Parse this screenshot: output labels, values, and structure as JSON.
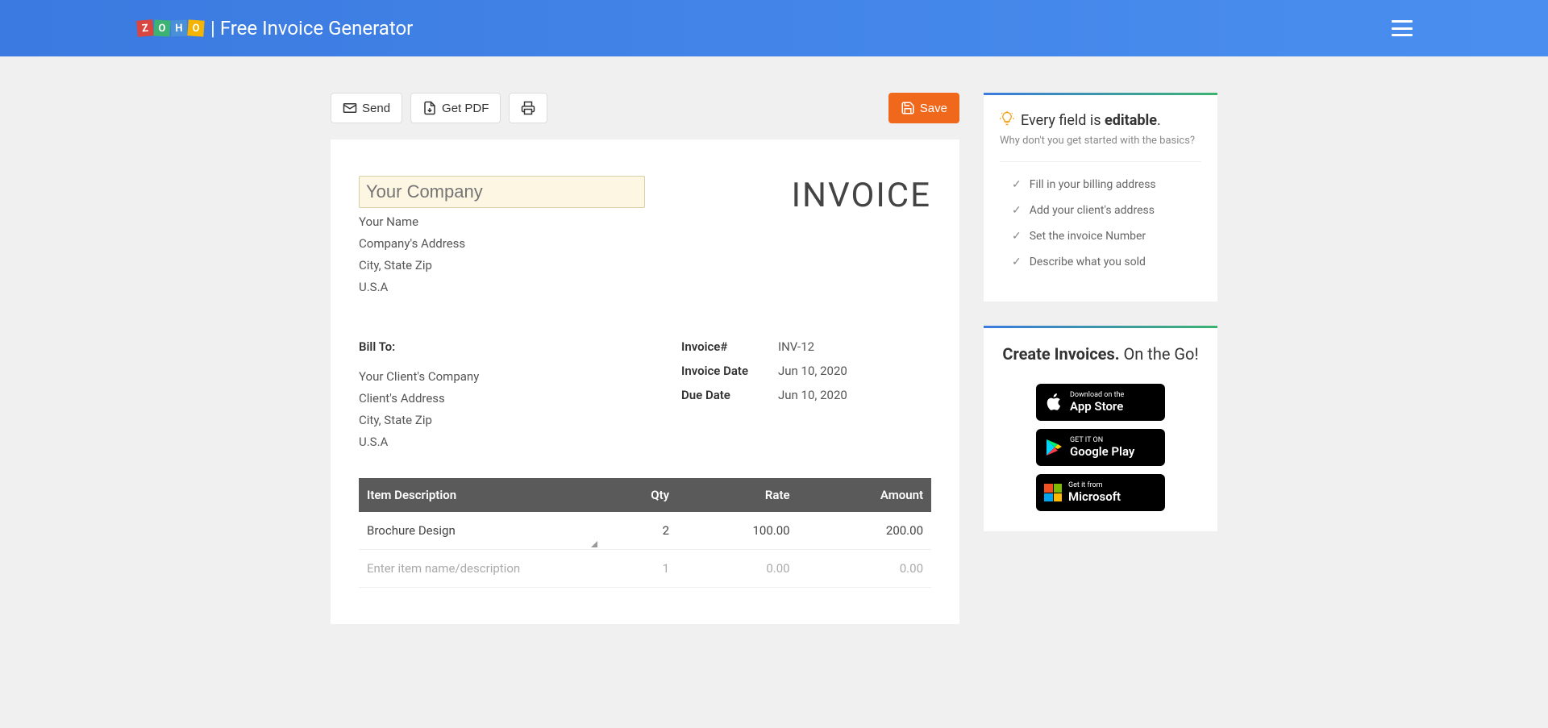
{
  "header": {
    "title": "| Free Invoice Generator"
  },
  "toolbar": {
    "send": "Send",
    "getPdf": "Get PDF",
    "save": "Save"
  },
  "invoice": {
    "companyPlaceholder": "Your Company",
    "yourName": "Your Name",
    "companyAddress": "Company's Address",
    "cityStateZip": "City, State Zip",
    "country": "U.S.A",
    "title": "INVOICE",
    "billToLabel": "Bill To:",
    "clientCompany": "Your Client's Company",
    "clientAddress": "Client's Address",
    "clientCity": "City, State Zip",
    "clientCountry": "U.S.A",
    "meta": {
      "invoiceNumLabel": "Invoice#",
      "invoiceNum": "INV-12",
      "invoiceDateLabel": "Invoice Date",
      "invoiceDate": "Jun 10, 2020",
      "dueDateLabel": "Due Date",
      "dueDate": "Jun 10, 2020"
    },
    "columns": {
      "desc": "Item Description",
      "qty": "Qty",
      "rate": "Rate",
      "amount": "Amount"
    },
    "items": [
      {
        "desc": "Brochure Design",
        "qty": "2",
        "rate": "100.00",
        "amount": "200.00"
      }
    ],
    "emptyRow": {
      "desc": "Enter item name/description",
      "qty": "1",
      "rate": "0.00",
      "amount": "0.00"
    }
  },
  "sidebar": {
    "editablePrefix": "Every field is ",
    "editableBold": "editable",
    "editableSuffix": ".",
    "sub": "Why don't you get started with the basics?",
    "checklist": [
      "Fill in your billing address",
      "Add your client's address",
      "Set the invoice Number",
      "Describe what you sold"
    ],
    "createPrefix": "Create Invoices.",
    "createSuffix": " On the Go!",
    "stores": {
      "apple": {
        "small": "Download on the",
        "big": "App Store"
      },
      "google": {
        "small": "GET IT ON",
        "big": "Google Play"
      },
      "ms": {
        "small": "Get it from",
        "big": "Microsoft"
      }
    }
  }
}
